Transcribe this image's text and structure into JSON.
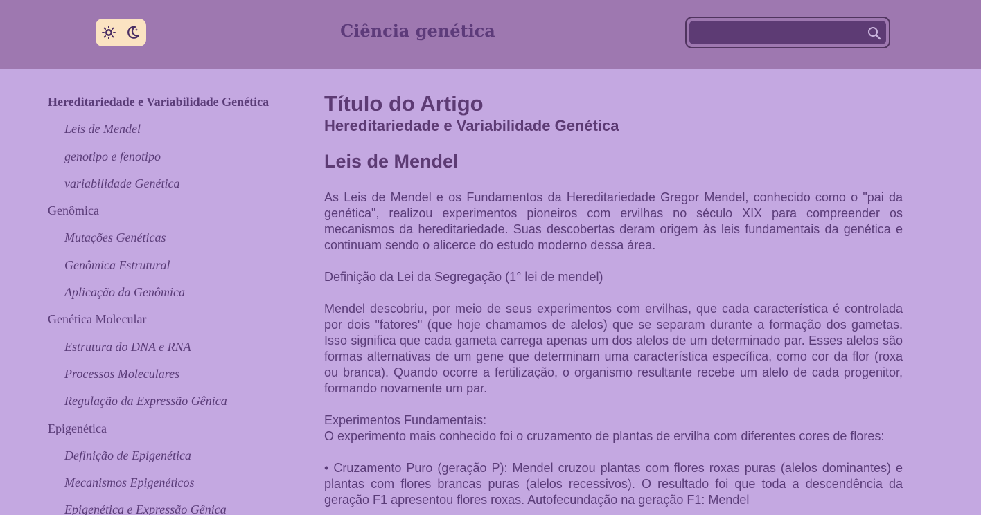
{
  "header": {
    "title": "Ciência genética",
    "search": {
      "value": "",
      "placeholder": ""
    },
    "theme_toggle": {
      "light_icon": "sun-icon",
      "dark_icon": "moon-icon"
    }
  },
  "sidebar": {
    "sections": [
      {
        "label": "Hereditariedade e Variabilidade Genética",
        "active": true,
        "items": [
          "Leis de Mendel",
          "genotipo e fenotipo",
          "variabilidade Genética"
        ]
      },
      {
        "label": "Genômica",
        "active": false,
        "items": [
          "Mutações Genéticas",
          "Genômica Estrutural",
          "Aplicação da Genômica"
        ]
      },
      {
        "label": "Genética Molecular",
        "active": false,
        "items": [
          "Estrutura do DNA e RNA",
          "Processos Moleculares",
          "Regulação da Expressão Gênica"
        ]
      },
      {
        "label": "Epigenética",
        "active": false,
        "items": [
          "Definição de Epigenética",
          "Mecanismos Epigenéticos",
          "Epigenética e Expressão Gênica"
        ]
      }
    ]
  },
  "article": {
    "title": "Título do Artigo",
    "subtitle": "Hereditariedade e Variabilidade Genética",
    "section_heading": "Leis de Mendel",
    "paragraphs": {
      "p1": "As Leis de Mendel e os Fundamentos da Hereditariedade Gregor Mendel, conhecido como o \"pai da genética\", realizou experimentos pioneiros com ervilhas no século XIX para compreender os mecanismos da hereditariedade. Suas descobertas deram origem às leis fundamentais da genética e continuam sendo o alicerce do estudo moderno dessa área.",
      "p2": "Definição da Lei da Segregação (1° lei de mendel)",
      "p3": "Mendel descobriu, por meio de seus experimentos com ervilhas, que cada característica é controlada por dois \"fatores\" (que hoje chamamos de alelos) que se separam durante a formação dos gametas. Isso significa que cada gameta carrega apenas um dos alelos de um determinado par. Esses alelos são formas alternativas de um gene que determinam uma característica específica, como cor da flor (roxa ou branca). Quando ocorre a fertilização, o organismo resultante recebe um alelo de cada progenitor, formando novamente um par.",
      "p4_heading": "Experimentos Fundamentais:",
      "p4_body": "O experimento mais conhecido foi o cruzamento de plantas de ervilha com diferentes cores de flores:",
      "p5": "• Cruzamento Puro (geração P): Mendel cruzou plantas com flores roxas puras (alelos dominantes) e plantas com flores brancas puras (alelos recessivos). O resultado foi que toda a descendência da geração F1 apresentou flores roxas. Autofecundação na geração F1: Mendel"
    }
  }
}
